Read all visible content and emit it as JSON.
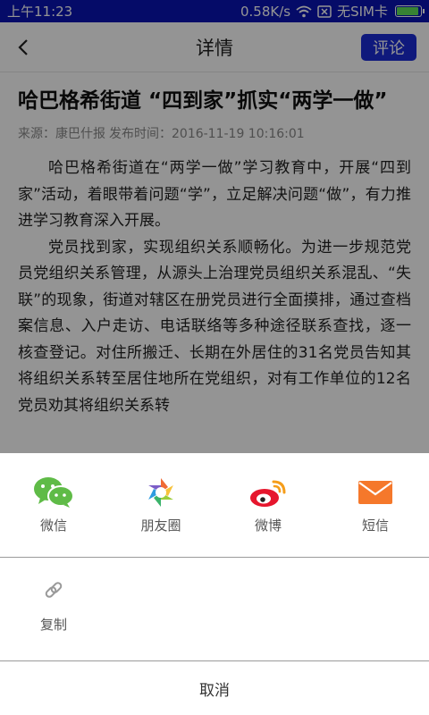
{
  "status_bar": {
    "time": "上午11:23",
    "speed": "0.58K/s",
    "sim": "无SIM卡",
    "battery_level": 0.92
  },
  "header": {
    "title": "详情",
    "comment_label": "评论"
  },
  "article": {
    "title": "哈巴格希街道 “四到家”抓实“两学一做”",
    "source": "来源：康巴什报",
    "publish_time": "发布时间：2016-11-19 10:16:01",
    "paragraphs": [
      "哈巴格希街道在“两学一做”学习教育中，开展“四到家”活动，着眼带着问题“学”，立足解决问题“做”，有力推进学习教育深入开展。",
      "党员找到家，实现组织关系顺畅化。为进一步规范党员党组织关系管理，从源头上治理党员组织关系混乱、“失联”的现象，街道对辖区在册党员进行全面摸排，通过查档案信息、入户走访、电话联络等多种途径联系查找，逐一核查登记。对住所搬迁、长期在外居住的31名党员告知其将组织关系转至居住地所在党组织，对有工作单位的12名党员劝其将组织关系转"
    ]
  },
  "share": {
    "items": [
      {
        "label": "微信",
        "icon": "wechat-icon"
      },
      {
        "label": "朋友圈",
        "icon": "moments-icon"
      },
      {
        "label": "微博",
        "icon": "weibo-icon"
      },
      {
        "label": "短信",
        "icon": "sms-icon"
      }
    ],
    "copy_label": "复制",
    "cancel_label": "取消"
  }
}
